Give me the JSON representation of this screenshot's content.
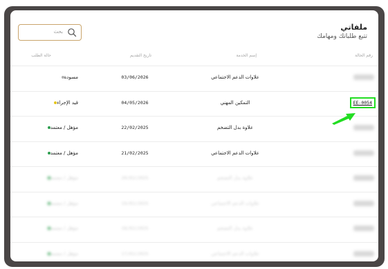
{
  "header": {
    "title": "ملفاتي",
    "subtitle": "تتبع طلباتك ومهامك"
  },
  "search": {
    "placeholder": "بحث"
  },
  "columns": {
    "case_number": "رقم الحالة",
    "service_name": "إسم الخدمة",
    "submission_date": "تاريخ التقديم",
    "request_status": "حالة الطلب"
  },
  "rows": [
    {
      "case_number": "",
      "service": "علاوات الدعم الاجتماعي",
      "date": "03/06/2026",
      "status": "مسودة",
      "status_color": "#b0b0b0"
    },
    {
      "case_number": "EE-0054",
      "service": "التمكين المهني",
      "date": "04/05/2026",
      "status": "قيد الإجراء",
      "status_color": "#e6c619"
    },
    {
      "case_number": "",
      "service": "علاوة بدل التضخم",
      "date": "22/02/2025",
      "status": "مؤهل / معتمد",
      "status_color": "#2e9e4f"
    },
    {
      "case_number": "",
      "service": "علاوات الدعم الاجتماعي",
      "date": "21/02/2025",
      "status": "مؤهل / معتمد",
      "status_color": "#2e9e4f"
    },
    {
      "case_number": "",
      "service": "علاوة بدل التضخم",
      "date": "20/02/2025",
      "status": "مؤهل / معتمد",
      "status_color": "#2e9e4f"
    },
    {
      "case_number": "",
      "service": "علاوات الدعم الاجتماعي",
      "date": "19/02/2025",
      "status": "مؤهل / معتمد",
      "status_color": "#2e9e4f"
    },
    {
      "case_number": "",
      "service": "علاوة بدل التضخم",
      "date": "18/02/2025",
      "status": "مؤهل / معتمد",
      "status_color": "#2e9e4f"
    },
    {
      "case_number": "",
      "service": "علاوات الدعم الاجتماعي",
      "date": "17/02/2025",
      "status": "مؤهل / معتمد",
      "status_color": "#2e9e4f"
    }
  ],
  "icons": {
    "search": "search-icon",
    "pointer": "green-arrow-icon"
  },
  "colors": {
    "search_border": "#c9a46b",
    "highlight": "#22dd22",
    "frame": "#4a4646"
  }
}
